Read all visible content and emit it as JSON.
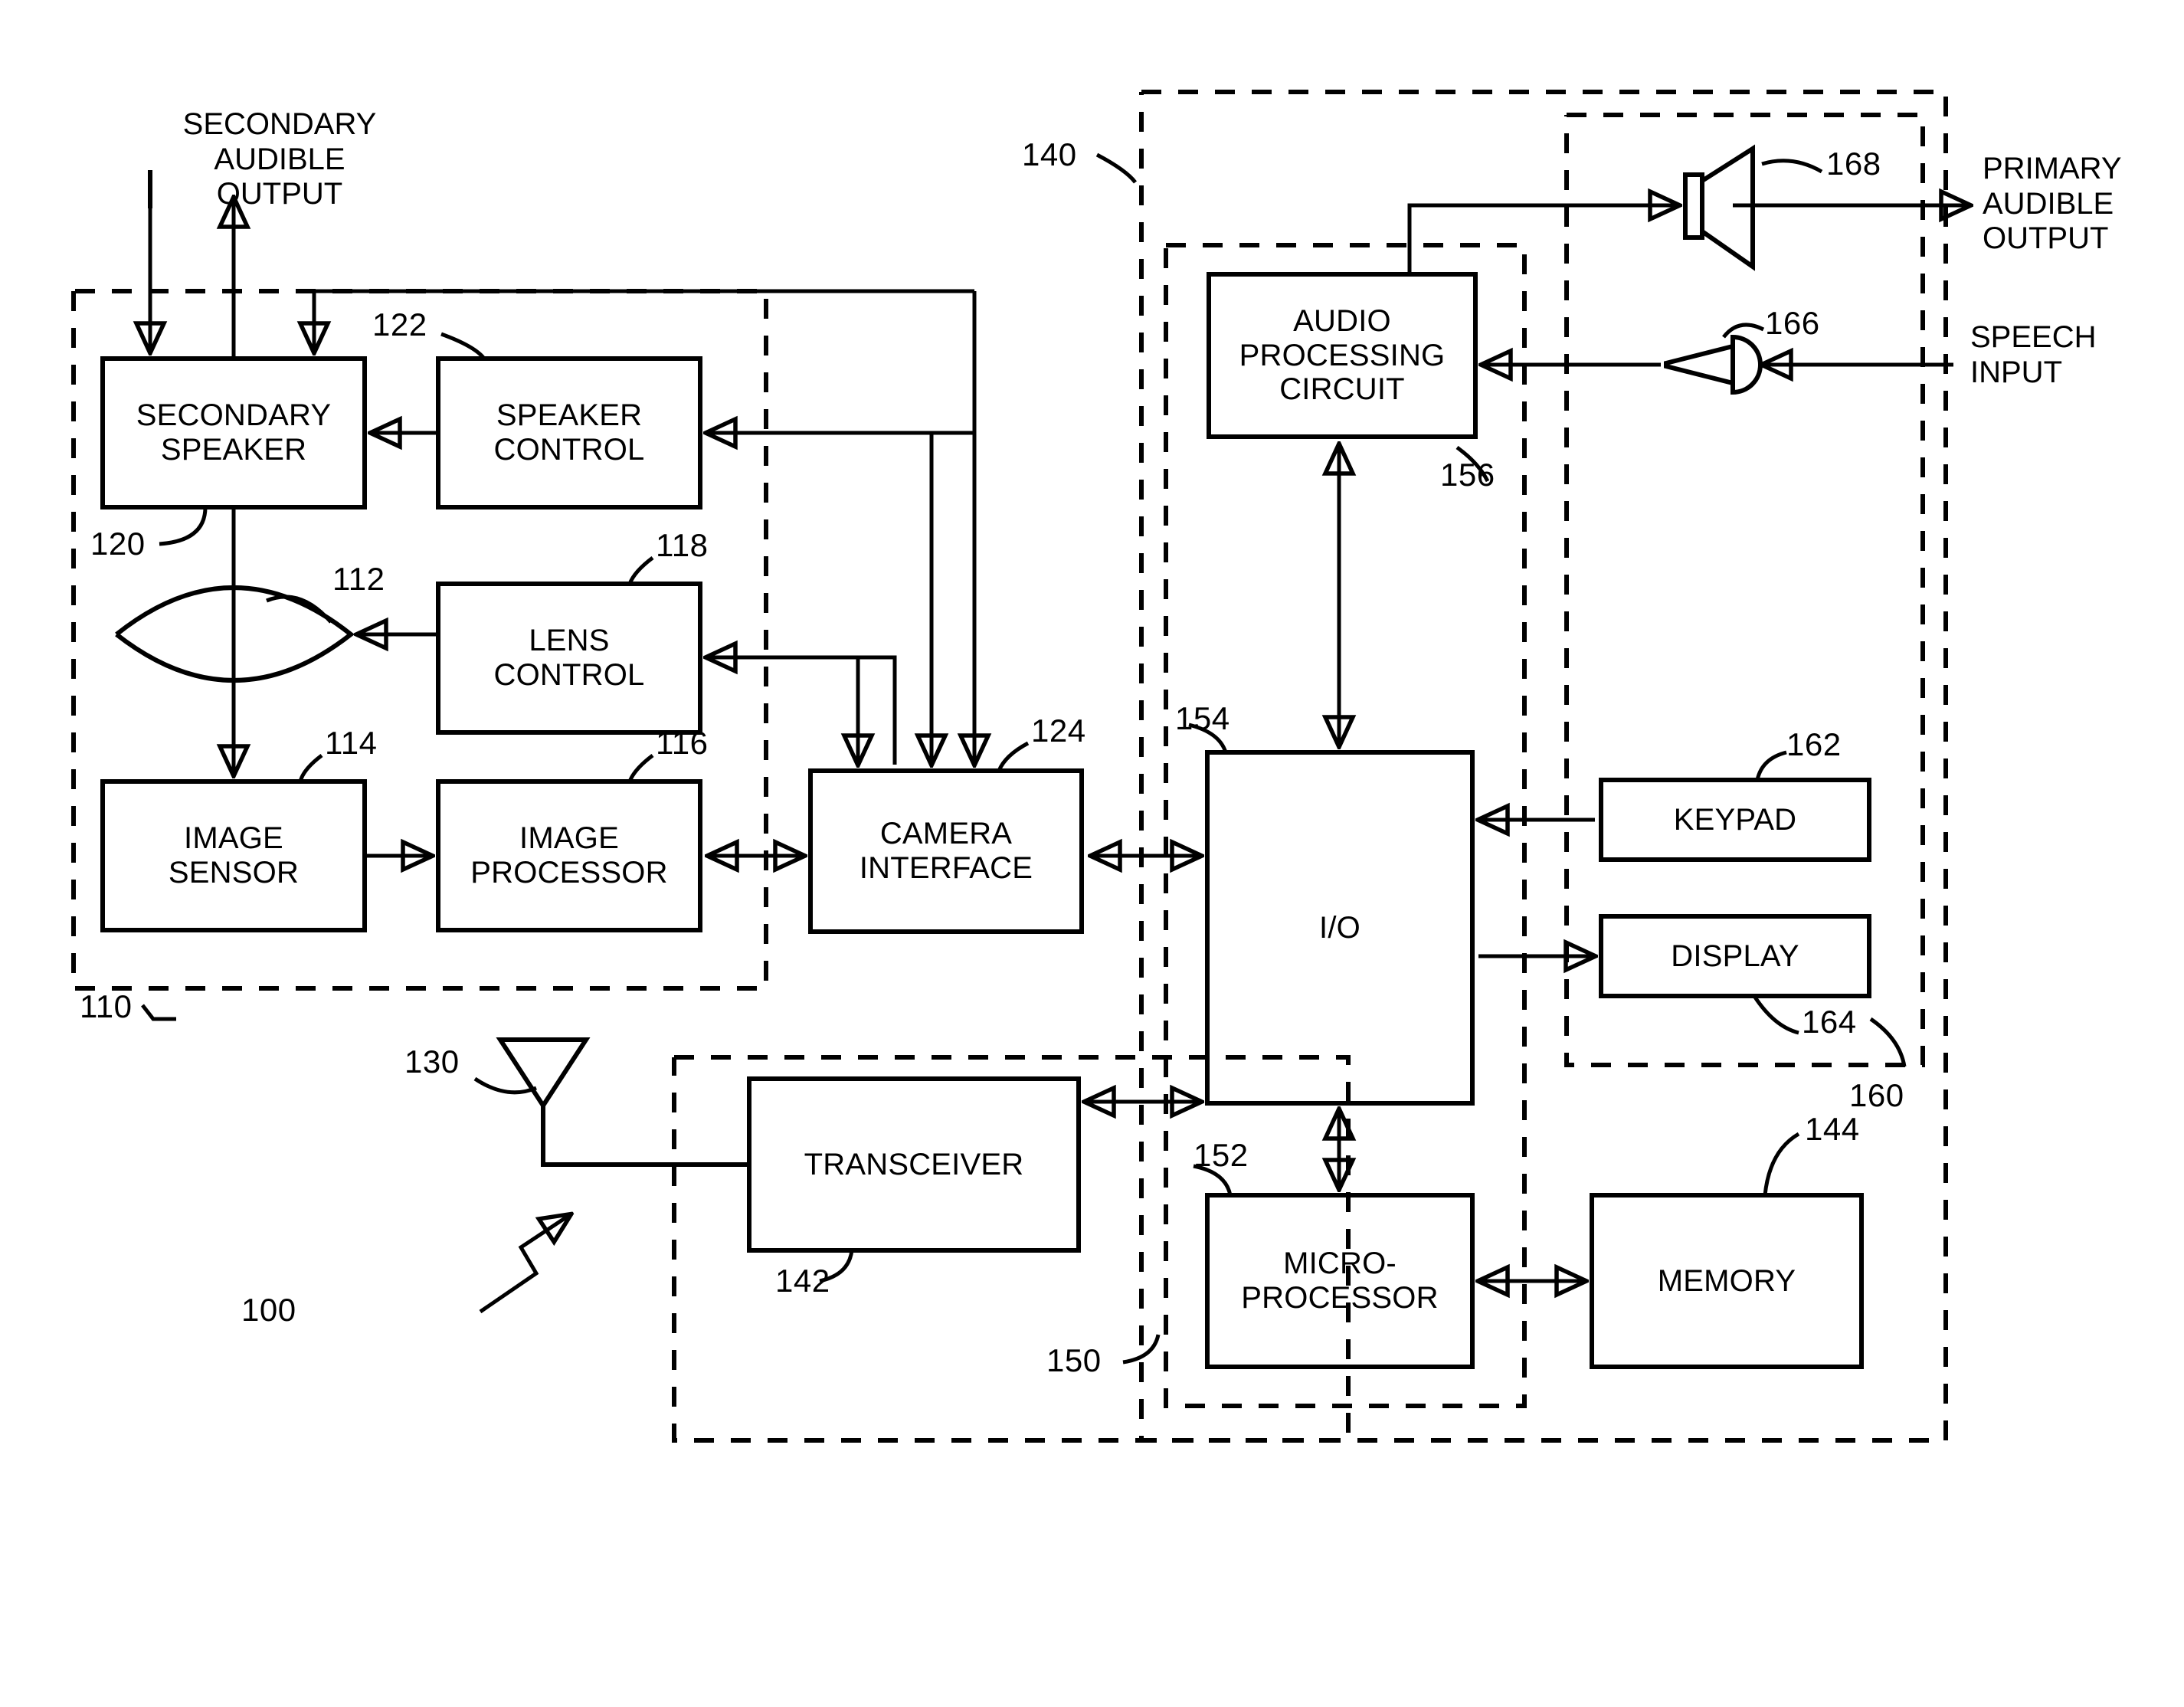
{
  "figure": {
    "title": "Camera-equipped wireless communication device block diagram",
    "device_ref": "100"
  },
  "external_labels": [
    {
      "id": "secondary-audible-output",
      "text": "SECONDARY\nAUDIBLE\nOUTPUT",
      "align": "center"
    },
    {
      "id": "primary-audible-output",
      "text": "PRIMARY\nAUDIBLE\nOUTPUT",
      "align": "left"
    },
    {
      "id": "speech-input",
      "text": "SPEECH\nINPUT",
      "align": "left"
    }
  ],
  "blocks": [
    {
      "id": "secondary-speaker",
      "label": "SECONDARY\nSPEAKER",
      "ref": "120"
    },
    {
      "id": "speaker-control",
      "label": "SPEAKER\nCONTROL",
      "ref": "122"
    },
    {
      "id": "lens-control",
      "label": "LENS\nCONTROL",
      "ref": "118"
    },
    {
      "id": "image-sensor",
      "label": "IMAGE\nSENSOR",
      "ref": "114"
    },
    {
      "id": "image-processor",
      "label": "IMAGE\nPROCESSOR",
      "ref": "116"
    },
    {
      "id": "camera-interface",
      "label": "CAMERA\nINTERFACE",
      "ref": "124"
    },
    {
      "id": "audio-processing-circuit",
      "label": "AUDIO\nPROCESSING\nCIRCUIT",
      "ref": "156"
    },
    {
      "id": "io",
      "label": "I/O",
      "ref": "154"
    },
    {
      "id": "keypad",
      "label": "KEYPAD",
      "ref": "162"
    },
    {
      "id": "display",
      "label": "DISPLAY",
      "ref": "164"
    },
    {
      "id": "transceiver",
      "label": "TRANSCEIVER",
      "ref": "142"
    },
    {
      "id": "microprocessor",
      "label": "MICRO-\nPROCESSOR",
      "ref": "152"
    },
    {
      "id": "memory",
      "label": "MEMORY",
      "ref": "144"
    }
  ],
  "symbols": [
    {
      "id": "lens",
      "name": "lens",
      "ref": "112"
    },
    {
      "id": "antenna",
      "name": "antenna",
      "ref": "130"
    },
    {
      "id": "primary-speaker",
      "name": "speaker",
      "ref": "168"
    },
    {
      "id": "microphone",
      "name": "microphone",
      "ref": "166"
    }
  ],
  "groups": [
    {
      "id": "camera-module",
      "ref": "110"
    },
    {
      "id": "radio-module",
      "ref": "140"
    },
    {
      "id": "control-module",
      "ref": "150"
    },
    {
      "id": "user-interface-module",
      "ref": "160"
    }
  ],
  "ref_numbers": {
    "r100": "100",
    "r110": "110",
    "r112": "112",
    "r114": "114",
    "r116": "116",
    "r118": "118",
    "r120": "120",
    "r122": "122",
    "r124": "124",
    "r130": "130",
    "r140": "140",
    "r142": "142",
    "r144": "144",
    "r150": "150",
    "r152": "152",
    "r154": "154",
    "r156": "156",
    "r160": "160",
    "r162": "162",
    "r164": "164",
    "r166": "166",
    "r168": "168"
  },
  "block_labels": {
    "secondary_speaker": "SECONDARY\nSPEAKER",
    "speaker_control": "SPEAKER\nCONTROL",
    "lens_control": "LENS\nCONTROL",
    "image_sensor": "IMAGE\nSENSOR",
    "image_processor": "IMAGE\nPROCESSOR",
    "camera_interface": "CAMERA\nINTERFACE",
    "audio_processing_circuit": "AUDIO\nPROCESSING\nCIRCUIT",
    "io": "I/O",
    "keypad": "KEYPAD",
    "display": "DISPLAY",
    "transceiver": "TRANSCEIVER",
    "microprocessor": "MICRO-\nPROCESSOR",
    "memory": "MEMORY"
  },
  "text_labels": {
    "secondary_audible_output": "SECONDARY\nAUDIBLE\nOUTPUT",
    "primary_audible_output": "PRIMARY\nAUDIBLE\nOUTPUT",
    "speech_input": "SPEECH\nINPUT"
  },
  "colors": {
    "line": "#000000",
    "background": "#ffffff"
  }
}
